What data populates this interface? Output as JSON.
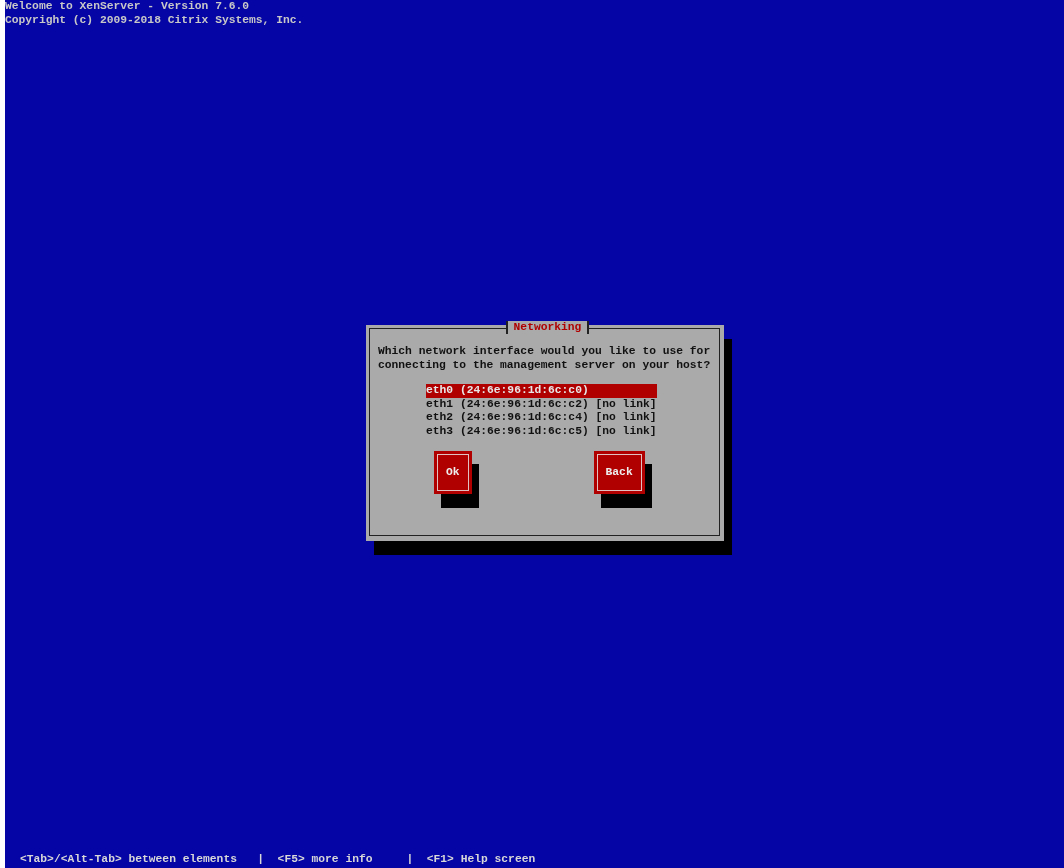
{
  "header": {
    "lines": [
      "Welcome to XenServer - Version 7.6.0",
      "Copyright (c) 2009-2018 Citrix Systems, Inc."
    ]
  },
  "dialog": {
    "title": "Networking",
    "prompt": "Which network interface would you like to use for\nconnecting to the management server on your host?",
    "interfaces": [
      {
        "label": "eth0 (24:6e:96:1d:6c:c0)",
        "selected": true
      },
      {
        "label": "eth1 (24:6e:96:1d:6c:c2) [no link]",
        "selected": false
      },
      {
        "label": "eth2 (24:6e:96:1d:6c:c4) [no link]",
        "selected": false
      },
      {
        "label": "eth3 (24:6e:96:1d:6c:c5) [no link]",
        "selected": false
      }
    ],
    "buttons": [
      "Ok",
      "Back"
    ]
  },
  "status_bar": "<Tab>/<Alt-Tab> between elements   |  <F5> more info     |  <F1> Help screen"
}
